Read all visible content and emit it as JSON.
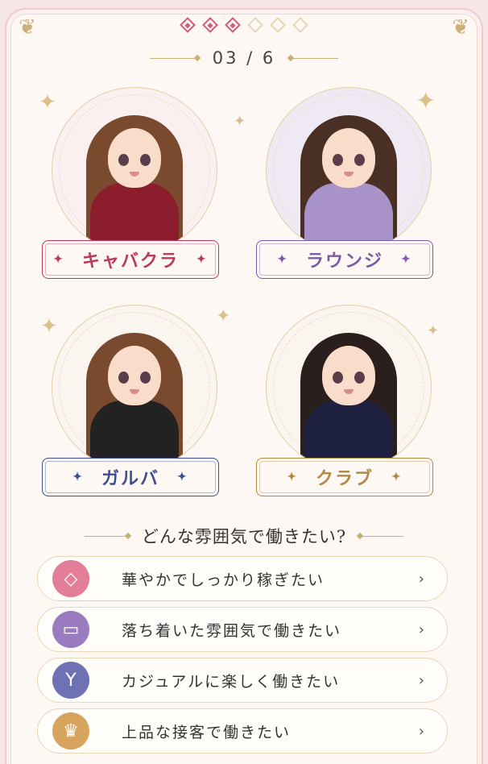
{
  "progress": {
    "counter": "03 / 6",
    "current_step": 3,
    "total_steps": 6
  },
  "cards": [
    {
      "label": "キャバクラ",
      "accent": "#b83a5e",
      "bg": "#fbf0f0",
      "hair": "#7a4a2e",
      "dress": "#8c1d2c"
    },
    {
      "label": "ラウンジ",
      "accent": "#7b5aa6",
      "bg": "#efe9f4",
      "hair": "#4a2f25",
      "dress": "#a892c8"
    },
    {
      "label": "ガルバ",
      "accent": "#3e4f8e",
      "bg": "#fbf5ef",
      "hair": "#7a4a2e",
      "dress": "#222222"
    },
    {
      "label": "クラブ",
      "accent": "#b08a45",
      "bg": "#fbf5ef",
      "hair": "#2a1f1c",
      "dress": "#1e2240"
    }
  ],
  "question": "どんな雰囲気で働きたい?",
  "options": [
    {
      "label": "華やかでしっかり稼ぎたい",
      "icon": "diamond-icon",
      "glyph": "◇",
      "color": "#e27e97"
    },
    {
      "label": "落ち着いた雰囲気で働きたい",
      "icon": "sofa-icon",
      "glyph": "▭",
      "color": "#9a7bbf"
    },
    {
      "label": "カジュアルに楽しく働きたい",
      "icon": "cocktail-icon",
      "glyph": "Y",
      "color": "#6e72b4"
    },
    {
      "label": "上品な接客で働きたい",
      "icon": "crown-icon",
      "glyph": "♛",
      "color": "#d6a45c"
    }
  ],
  "chevron": "›"
}
